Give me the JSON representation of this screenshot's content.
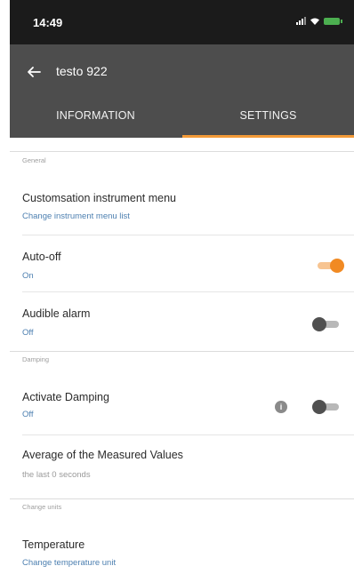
{
  "status_bar": {
    "time": "14:49"
  },
  "header": {
    "title": "testo 922"
  },
  "tabs": [
    {
      "label": "INFORMATION",
      "active": false
    },
    {
      "label": "SETTINGS",
      "active": true
    }
  ],
  "sections": {
    "general": "General",
    "damping": "Damping",
    "change_units": "Change units"
  },
  "rows": {
    "customisation": {
      "title": "Customsation instrument menu",
      "subtitle": "Change instrument menu list"
    },
    "auto_off": {
      "title": "Auto-off",
      "subtitle": "On",
      "toggle": true
    },
    "audible_alarm": {
      "title": "Audible alarm",
      "subtitle": "Off",
      "toggle": false
    },
    "activate_damping": {
      "title": "Activate Damping",
      "subtitle": "Off",
      "toggle": false,
      "info_icon": "i"
    },
    "average": {
      "title": "Average of the Measured Values",
      "subtitle": "the last 0 seconds"
    },
    "temperature": {
      "title": "Temperature",
      "subtitle": "Change temperature unit"
    }
  },
  "colors": {
    "accent": "#f18a23",
    "link": "#4c7fb0",
    "app_bar": "#4d4d4d",
    "status_bar": "#1b1b1b"
  },
  "icons": [
    "back-arrow-icon",
    "signal-icon",
    "wifi-icon",
    "battery-icon",
    "info-icon"
  ]
}
